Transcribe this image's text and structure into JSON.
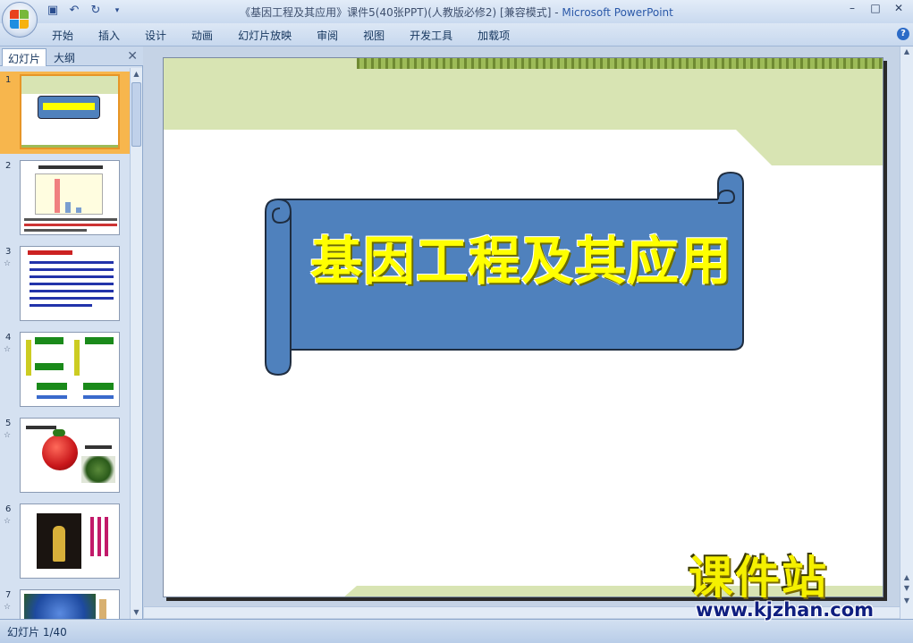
{
  "window": {
    "title": "《基因工程及其应用》课件5(40张PPT)(人教版必修2) [兼容模式] - ",
    "app_name": "Microsoft PowerPoint",
    "controls": [
      "–",
      "□",
      "✕"
    ]
  },
  "quick_access": {
    "icons": [
      "save-icon",
      "undo-icon",
      "redo-icon",
      "customize-icon"
    ]
  },
  "ribbon": {
    "tabs": [
      "开始",
      "插入",
      "设计",
      "动画",
      "幻灯片放映",
      "审阅",
      "视图",
      "开发工具",
      "加载项"
    ],
    "help": "?"
  },
  "panel": {
    "tab_slides": "幻灯片",
    "tab_outline": "大纲",
    "close": "✕"
  },
  "thumbnails": [
    {
      "num": "1",
      "has_anim": false
    },
    {
      "num": "2",
      "has_anim": false
    },
    {
      "num": "3",
      "has_anim": true
    },
    {
      "num": "4",
      "has_anim": true
    },
    {
      "num": "5",
      "has_anim": true
    },
    {
      "num": "6",
      "has_anim": true
    },
    {
      "num": "7",
      "has_anim": true
    }
  ],
  "anim_mark": "☆",
  "slide": {
    "title": "基因工程及其应用"
  },
  "status": {
    "text": "幻灯片 1/40"
  },
  "watermark": {
    "name": "课件站",
    "url": "www.kjzhan.com"
  },
  "colors": {
    "scroll_fill": "#4f81bd",
    "title_text": "#ffff00",
    "banner_green": "#d8e4b3",
    "border_green": "#9dbb58"
  }
}
